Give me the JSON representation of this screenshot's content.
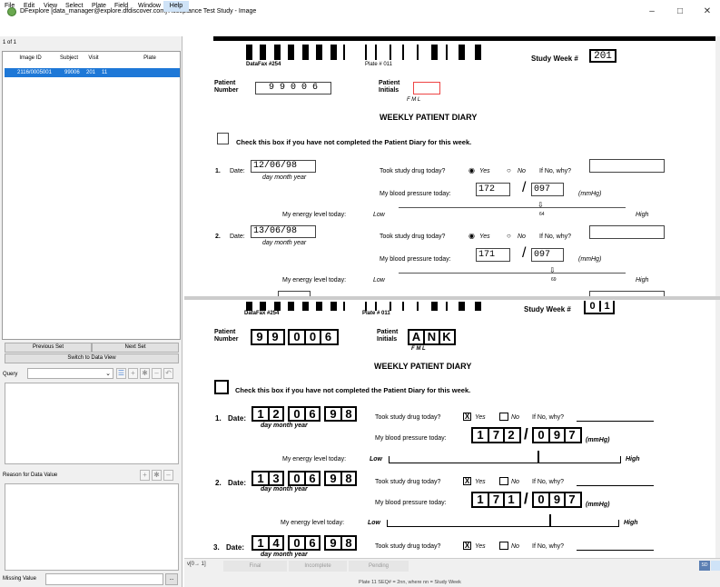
{
  "window": {
    "title": "DFexplore [data_manager@explore.dfdiscover.com] Acceptance Test Study - Image"
  },
  "menu": [
    "File",
    "Edit",
    "View",
    "Select",
    "Plate",
    "Field",
    "Window",
    "Help"
  ],
  "left": {
    "set_count": "1 of 1",
    "columns": [
      "Image ID",
      "Subject",
      "Visit",
      "Plate"
    ],
    "row": {
      "image_id": "2116/0005001",
      "subject": "99006",
      "visit": "201",
      "plate": "11"
    },
    "prev_set": "Previous Set",
    "next_set": "Next Set",
    "switch_view": "Switch to Data View",
    "query_label": "Query",
    "reason_label": "Reason for Data Value",
    "missing_label": "Missing Value",
    "missing_btn": "..."
  },
  "form1": {
    "datafax": "DataFax #254",
    "plate": "Plate # 011",
    "study_week_label": "Study Week #",
    "study_week": "201",
    "patient_number_label1": "Patient",
    "patient_number_label2": "Number",
    "patient_number": "9 9 0 0 6",
    "patient_initials_label1": "Patient",
    "patient_initials_label2": "Initials",
    "fml": "F   M   L",
    "heading": "WEEKLY PATIENT DIARY",
    "checkbox_text": "Check this box if you have not completed the Patient Diary for this week.",
    "e1_num": "1.",
    "date_label": "Date:",
    "e1_date": "12/06/98",
    "dmy": "day      month       year",
    "took_label": "Took study drug today?",
    "yes": "Yes",
    "no": "No",
    "ifno": "If No, why?",
    "bp_label": "My blood pressure today:",
    "e1_sys": "172",
    "e1_dia": "097",
    "slash": "/",
    "mmhg": "(mmHg)",
    "energy_label": "My energy level today:",
    "low": "Low",
    "high": "High",
    "e1_energy": "64",
    "e2_num": "2.",
    "e2_date": "13/06/98",
    "e2_sys": "171",
    "e2_dia": "097",
    "e2_energy": "69"
  },
  "form2": {
    "datafax": "DataFax #254",
    "plate": "Plate # 011",
    "study_week_label": "Study Week #",
    "sw1": "0",
    "sw2": "1",
    "patient_number_label1": "Patient",
    "patient_number_label2": "Number",
    "pn": [
      "9",
      "9",
      "0",
      "0",
      "6"
    ],
    "patient_initials_label1": "Patient",
    "patient_initials_label2": "Initials",
    "pi": [
      "A",
      "N",
      "K"
    ],
    "fml": "F   M   L",
    "heading": "WEEKLY PATIENT DIARY",
    "checkbox_text": "Check this box if you have not completed the Patient Diary for this week.",
    "date_label": "Date:",
    "dmy": "day       month       year",
    "took_label": "Took study drug today?",
    "yes": "Yes",
    "no": "No",
    "ifno": "If No, why?",
    "bp_label": "My blood pressure today:",
    "mmhg": "(mmHg)",
    "energy_label": "My energy level today:",
    "low": "Low",
    "high": "High",
    "e1_num": "1.",
    "e1_date": [
      "1",
      "2",
      "0",
      "6",
      "9",
      "8"
    ],
    "e1_bp": [
      "1",
      "7",
      "2",
      "0",
      "9",
      "7"
    ],
    "e2_num": "2.",
    "e2_date": [
      "1",
      "3",
      "0",
      "6",
      "9",
      "8"
    ],
    "e2_bp": [
      "1",
      "7",
      "1",
      "0",
      "9",
      "7"
    ],
    "e3_num": "3.",
    "e3_date": [
      "1",
      "4",
      "0",
      "6",
      "9",
      "8"
    ],
    "x": "X"
  },
  "status": {
    "vnav": "v[0→ 1]",
    "tabs": [
      "Final",
      "Incomplete",
      "Pending"
    ],
    "text": "Plate 11 SEQ# = 2nn, where nn = Study Week",
    "sd": "SD"
  }
}
